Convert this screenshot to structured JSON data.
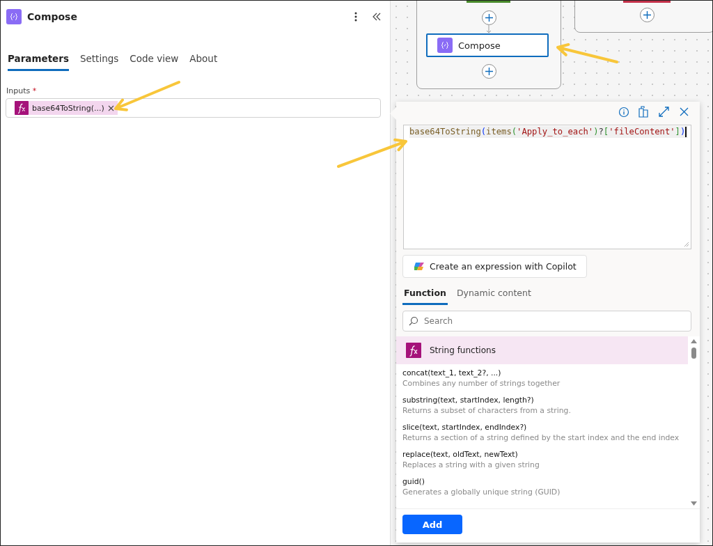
{
  "panel": {
    "title": "Compose",
    "tabs": [
      {
        "label": "Parameters",
        "selected": true
      },
      {
        "label": "Settings",
        "selected": false
      },
      {
        "label": "Code view",
        "selected": false
      },
      {
        "label": "About",
        "selected": false
      }
    ],
    "inputs": {
      "label": "Inputs",
      "required_mark": "*",
      "token": "base64ToString(...)"
    }
  },
  "canvas": {
    "nodes": [
      {
        "title": "Compose",
        "selected": true
      }
    ]
  },
  "expression_editor": {
    "code": [
      {
        "text": "base64ToString",
        "kind": "fn"
      },
      {
        "text": "(",
        "kind": "bracket1"
      },
      {
        "text": "items",
        "kind": "fn"
      },
      {
        "text": "(",
        "kind": "bracket2"
      },
      {
        "text": "'Apply_to_each'",
        "kind": "string"
      },
      {
        "text": ")",
        "kind": "bracket2"
      },
      {
        "text": "?",
        "kind": "punct"
      },
      {
        "text": "[",
        "kind": "bracket2"
      },
      {
        "text": "'fileContent'",
        "kind": "string"
      },
      {
        "text": "]",
        "kind": "bracket2"
      },
      {
        "text": ")",
        "kind": "bracket1"
      }
    ],
    "copilot_button": "Create an expression with Copilot",
    "tabs": [
      {
        "label": "Function",
        "selected": true
      },
      {
        "label": "Dynamic content",
        "selected": false
      }
    ],
    "search": {
      "placeholder": "Search"
    },
    "group": "String functions",
    "functions": [
      {
        "signature": "concat(text_1, text_2?, ...)",
        "description": "Combines any number of strings together"
      },
      {
        "signature": "substring(text, startIndex, length?)",
        "description": "Returns a subset of characters from a string."
      },
      {
        "signature": "slice(text, startIndex, endIndex?)",
        "description": "Returns a section of a string defined by the start index and the end index"
      },
      {
        "signature": "replace(text, oldText, newText)",
        "description": "Replaces a string with a given string"
      },
      {
        "signature": "guid()",
        "description": "Generates a globally unique string (GUID)"
      }
    ],
    "add_button": "Add"
  }
}
